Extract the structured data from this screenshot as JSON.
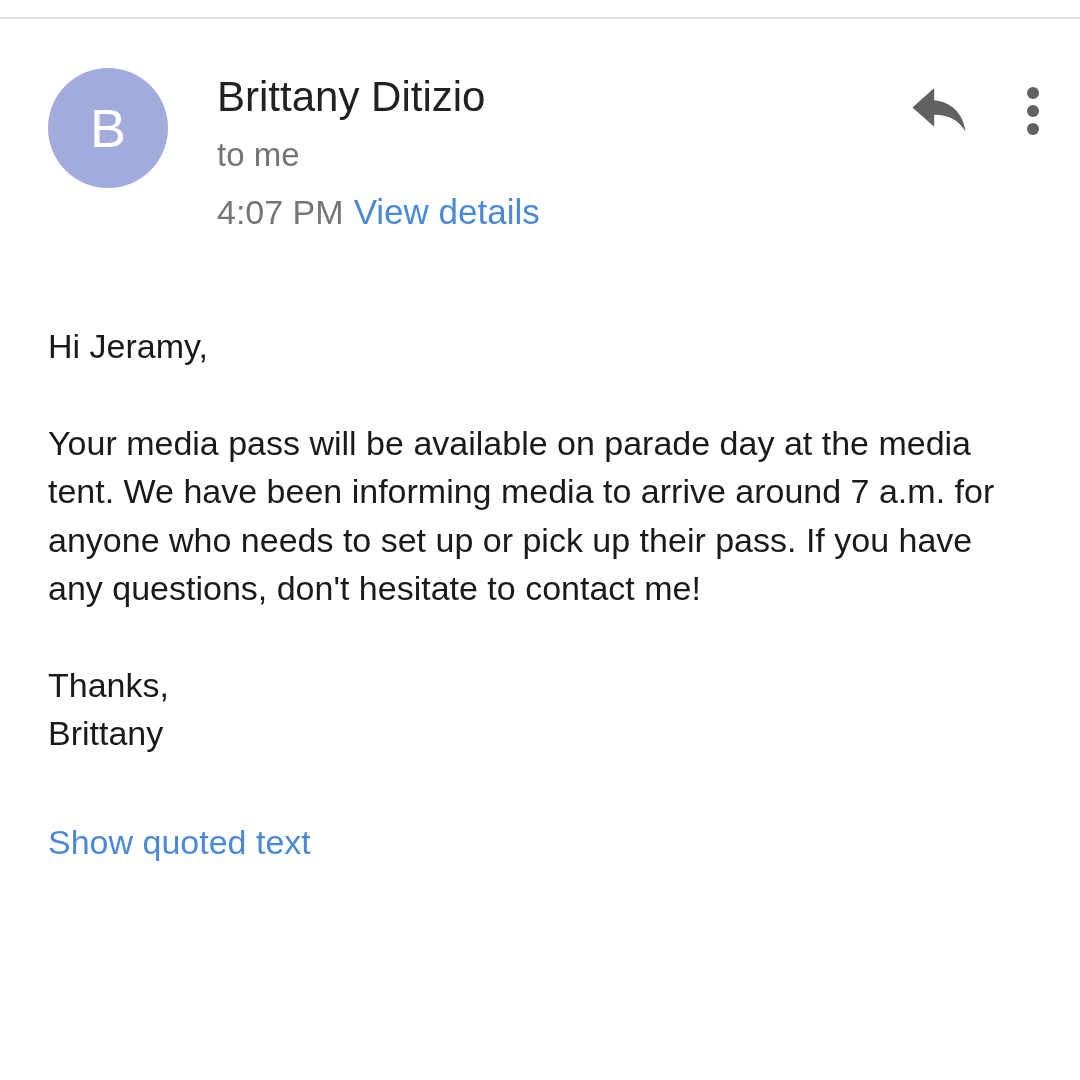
{
  "message": {
    "avatar_letter": "B",
    "sender": "Brittany Ditizio",
    "recipient": "to me",
    "time": "4:07 PM",
    "details_link": "View details"
  },
  "body": {
    "greeting": "Hi Jeramy,",
    "paragraph": "Your media pass will be available on parade day at the media tent. We have been informing media to arrive around 7 a.m. for anyone who needs to set up or pick up their pass. If you have any questions, don't hesitate to contact me!",
    "signoff": [
      "Thanks,",
      "Brittany"
    ]
  },
  "quoted_link": "Show quoted text"
}
